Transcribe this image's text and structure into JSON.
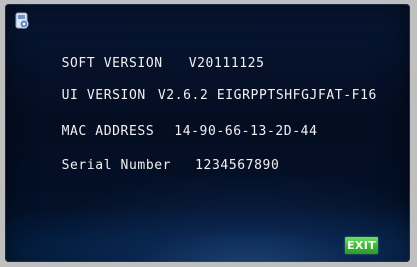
{
  "screen": {
    "icon": "device-settings-icon",
    "info": {
      "soft_version": {
        "label": "SOFT VERSION",
        "value": "V20111125"
      },
      "ui_version": {
        "label": "UI VERSION",
        "value": "V2.6.2 EIGRPPTSHFGJFAT-F16"
      },
      "mac_address": {
        "label": "MAC ADDRESS",
        "value": "14-90-66-13-2D-44"
      },
      "serial_number": {
        "label": "Serial Number",
        "value": "1234567890"
      }
    },
    "exit_button": {
      "label": "EXIT",
      "color": "#3fb43c"
    }
  },
  "colors": {
    "background": "#040d22",
    "text": "#f2f2f2"
  }
}
